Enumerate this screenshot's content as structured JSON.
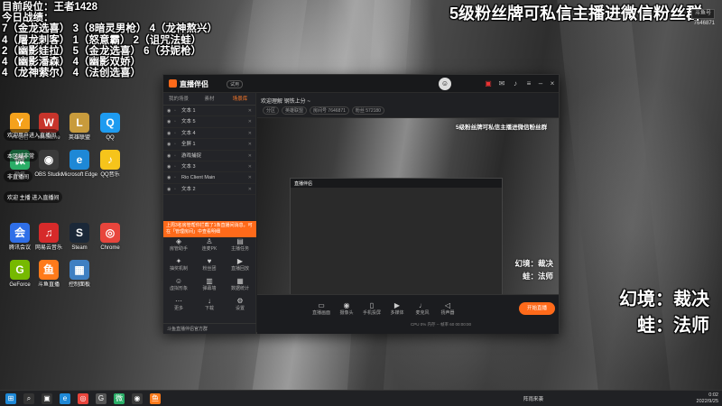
{
  "overlay_left": {
    "lines": [
      "目前段位：王者1428",
      "今日战绩：",
      "7（金龙选喜）  3（8暗灵男枪）  4（龙神熬兴）",
      "4（屠龙刺客）  1（怒意霸）  2（诅咒法蛙）",
      "2（幽影娃拉）  5（金龙选喜）  6（芬妮枪）",
      "4（幽影潘森）  4（幽影双娇）",
      "4（龙神萦尔）  4（法创选喜）"
    ]
  },
  "banner": "5级粉丝牌可私信主播进微信粉丝群",
  "douyu": {
    "logo": "斗鱼号",
    "id": "7646871"
  },
  "right_labels": {
    "line1": "幻境：裁决",
    "line2": "蛙：法师"
  },
  "desktop_icons": [
    {
      "label": "YY语音",
      "glyph": "Y",
      "color": "#f4a11c"
    },
    {
      "label": "WeGame",
      "glyph": "W",
      "color": "#c7342b"
    },
    {
      "label": "英雄联盟",
      "glyph": "L",
      "color": "#c89b3c"
    },
    {
      "label": "QQ",
      "glyph": "Q",
      "color": "#1e9bf0"
    },
    {
      "label": "微信",
      "glyph": "微",
      "color": "#2aae67"
    },
    {
      "label": "OBS Studio",
      "glyph": "◉",
      "color": "#3a3a3a"
    },
    {
      "label": "Microsoft Edge",
      "glyph": "e",
      "color": "#1e88d6"
    },
    {
      "label": "QQ音乐",
      "glyph": "♪",
      "color": "#f6c41b"
    },
    {
      "label": "腾讯会议",
      "glyph": "会",
      "color": "#2f6fe8"
    },
    {
      "label": "网易云音乐",
      "glyph": "♫",
      "color": "#d62a2a"
    },
    {
      "label": "Steam",
      "glyph": "S",
      "color": "#1b2838"
    },
    {
      "label": "Chrome",
      "glyph": "◎",
      "color": "#e8453c"
    },
    {
      "label": "GeForce",
      "glyph": "G",
      "color": "#76b900"
    },
    {
      "label": "斗鱼直播",
      "glyph": "鱼",
      "color": "#ff7a1a"
    },
    {
      "label": "控制面板",
      "glyph": "▦",
      "color": "#3f7fc2"
    }
  ],
  "comments": [
    "欢迎用户进入直播间",
    "本区域非常",
    "非直播间",
    "欢迎 主播 进入直播间"
  ],
  "app": {
    "name": "直播伴侣",
    "version": "试用",
    "left_tabs": [
      "我的场景",
      "素材",
      "场景库"
    ],
    "sources": [
      "文本 1",
      "文本 5",
      "文本 4",
      "全屏 1",
      "游戏捕捉",
      "文本 3",
      "Rio Client Main",
      "文本 2"
    ],
    "notice": "上周3名房管帮你拦截了1条直播间消息，可在「管理房间」中查看明细",
    "tools": [
      {
        "label": "房管助手",
        "glyph": "◈"
      },
      {
        "label": "连麦PK",
        "glyph": "♙"
      },
      {
        "label": "主播任务",
        "glyph": "▤"
      },
      {
        "label": "抽奖机制",
        "glyph": "✦"
      },
      {
        "label": "粉丝团",
        "glyph": "♥"
      },
      {
        "label": "直播回放",
        "glyph": "▶"
      },
      {
        "label": "虚拟形象",
        "glyph": "☺"
      },
      {
        "label": "弹幕墙",
        "glyph": "▥"
      },
      {
        "label": "数据统计",
        "glyph": "▦"
      },
      {
        "label": "更多",
        "glyph": "⋯"
      },
      {
        "label": "下载",
        "glyph": "↓"
      },
      {
        "label": "设置",
        "glyph": "⚙"
      }
    ],
    "left_footer": "斗鱼直播伴侣官方群",
    "room_name": "欢迎理解 钢铁上分 ~",
    "room_meta": [
      "分区",
      "英雄联盟",
      "房间号 7646871",
      "粉丝 572180"
    ],
    "preview_banner": "5级粉丝牌可私信主播进微信粉丝群",
    "preview_labels": {
      "line1": "幻境：裁决",
      "line2": "蛙：法师"
    },
    "controls": [
      {
        "label": "直播画面",
        "glyph": "▭"
      },
      {
        "label": "摄像头",
        "glyph": "◉"
      },
      {
        "label": "手机投屏",
        "glyph": "▯"
      },
      {
        "label": "多媒体",
        "glyph": "▶"
      },
      {
        "label": "麦克风",
        "glyph": "♩"
      },
      {
        "label": "扬声器",
        "glyph": "◁"
      }
    ],
    "start_button": "开始直播",
    "stats": "CPU 0%   内存 --   帧率 60   00:00:00"
  },
  "taskbar": {
    "items": [
      {
        "name": "windows",
        "glyph": "⊞",
        "color": "#1e88d6"
      },
      {
        "name": "search",
        "glyph": "⌕",
        "color": "#333"
      },
      {
        "name": "task-view",
        "glyph": "▣",
        "color": "#333"
      },
      {
        "name": "edge",
        "glyph": "e",
        "color": "#1e88d6"
      },
      {
        "name": "chrome",
        "glyph": "◎",
        "color": "#e8453c"
      },
      {
        "name": "g-app",
        "glyph": "G",
        "color": "#555"
      },
      {
        "name": "wechat",
        "glyph": "微",
        "color": "#2aae67"
      },
      {
        "name": "obs",
        "glyph": "◉",
        "color": "#3a3a3a"
      },
      {
        "name": "douyu",
        "glyph": "鱼",
        "color": "#ff7a1a"
      }
    ],
    "weather": "阵雨来袭",
    "time": "0:02",
    "date": "2022/9/25"
  }
}
